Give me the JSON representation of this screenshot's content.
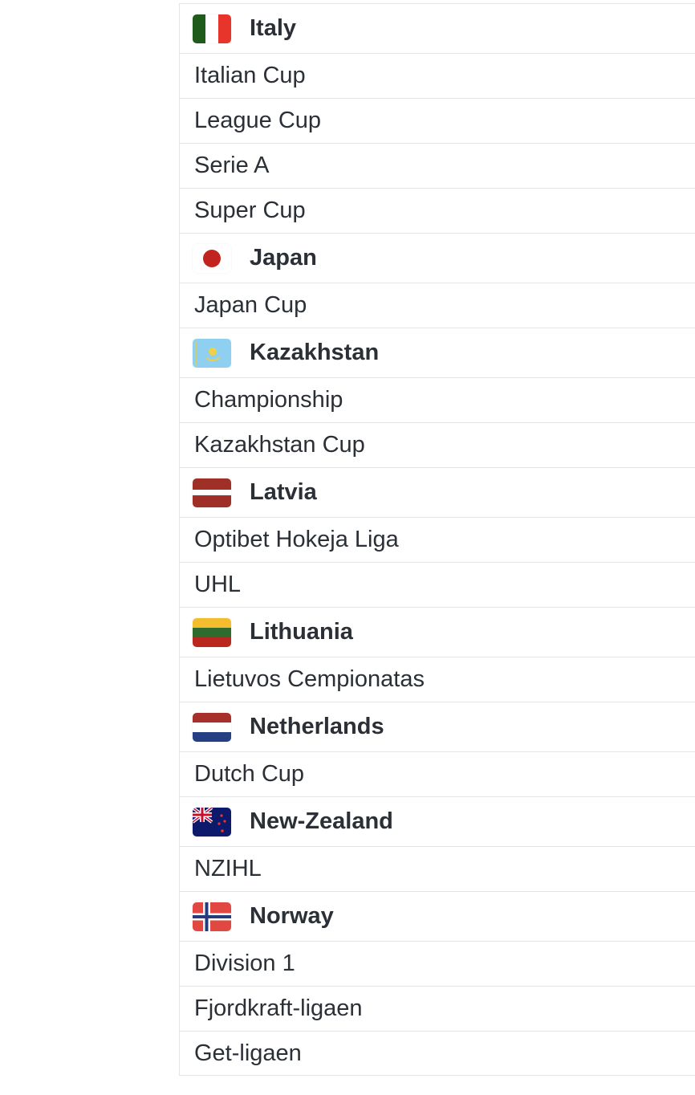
{
  "groups": [
    {
      "country": "Italy",
      "flag_icon": "italy-flag-icon",
      "leagues": [
        "Italian Cup",
        "League Cup",
        "Serie A",
        "Super Cup"
      ]
    },
    {
      "country": "Japan",
      "flag_icon": "japan-flag-icon",
      "leagues": [
        "Japan Cup"
      ]
    },
    {
      "country": "Kazakhstan",
      "flag_icon": "kazakhstan-flag-icon",
      "leagues": [
        "Championship",
        "Kazakhstan Cup"
      ]
    },
    {
      "country": "Latvia",
      "flag_icon": "latvia-flag-icon",
      "leagues": [
        "Optibet Hokeja Liga",
        "UHL"
      ]
    },
    {
      "country": "Lithuania",
      "flag_icon": "lithuania-flag-icon",
      "leagues": [
        "Lietuvos Cempionatas"
      ]
    },
    {
      "country": "Netherlands",
      "flag_icon": "netherlands-flag-icon",
      "leagues": [
        "Dutch Cup"
      ]
    },
    {
      "country": "New-Zealand",
      "flag_icon": "new-zealand-flag-icon",
      "leagues": [
        "NZIHL"
      ]
    },
    {
      "country": "Norway",
      "flag_icon": "norway-flag-icon",
      "leagues": [
        "Division 1",
        "Fjordkraft-ligaen",
        "Get-ligaen"
      ]
    }
  ],
  "colors": {
    "text": "#2b2f36",
    "divider": "#e3e5e8",
    "background": "#ffffff"
  }
}
